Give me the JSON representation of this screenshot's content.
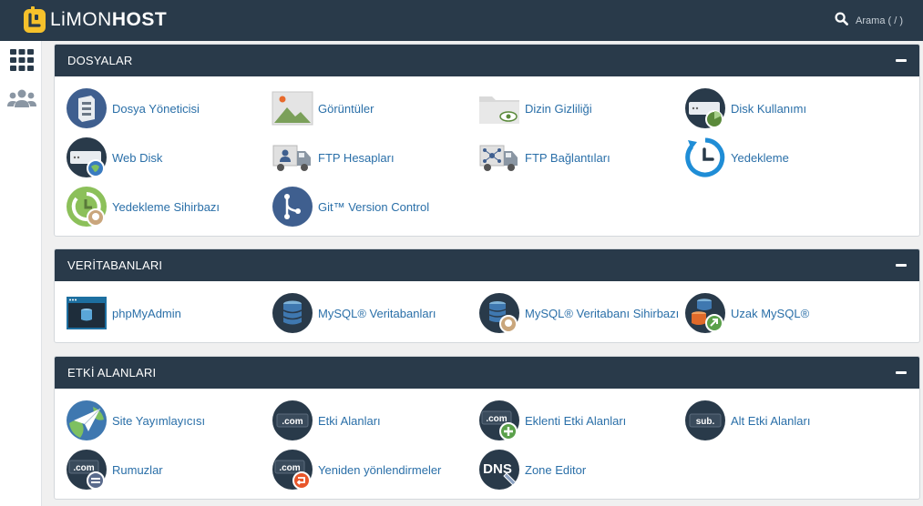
{
  "header": {
    "logo_prefix": "LiMON",
    "logo_suffix": "HOST",
    "search_label": "Arama ( / )"
  },
  "sidebar": {
    "items": [
      {
        "name": "apps-grid-icon"
      },
      {
        "name": "users-icon"
      }
    ]
  },
  "colors": {
    "topbar": "#293a4a",
    "panel_header": "#293a4a",
    "link": "#2a6fa8",
    "logo_yellow": "#f6c12b"
  },
  "panels": [
    {
      "title": "DOSYALAR",
      "items": [
        {
          "label": "Dosya Yöneticisi",
          "icon": "file-manager-icon"
        },
        {
          "label": "Görüntüler",
          "icon": "images-icon"
        },
        {
          "label": "Dizin Gizliliği",
          "icon": "directory-privacy-icon"
        },
        {
          "label": "Disk Kullanımı",
          "icon": "disk-usage-icon"
        },
        {
          "label": "Web Disk",
          "icon": "web-disk-icon"
        },
        {
          "label": "FTP Hesapları",
          "icon": "ftp-accounts-icon"
        },
        {
          "label": "FTP Bağlantıları",
          "icon": "ftp-connections-icon"
        },
        {
          "label": "Yedekleme",
          "icon": "backup-icon"
        },
        {
          "label": "Yedekleme Sihirbazı",
          "icon": "backup-wizard-icon"
        },
        {
          "label": "Git™ Version Control",
          "icon": "git-icon"
        }
      ]
    },
    {
      "title": "VERİTABANLARI",
      "items": [
        {
          "label": "phpMyAdmin",
          "icon": "phpmyadmin-icon"
        },
        {
          "label": "MySQL® Veritabanları",
          "icon": "mysql-databases-icon"
        },
        {
          "label": "MySQL® Veritabanı Sihirbazı",
          "icon": "mysql-wizard-icon"
        },
        {
          "label": "Uzak MySQL®",
          "icon": "remote-mysql-icon"
        }
      ]
    },
    {
      "title": "ETKİ ALANLARI",
      "items": [
        {
          "label": "Site Yayımlayıcısı",
          "icon": "site-publisher-icon",
          "icon_text": ""
        },
        {
          "label": "Etki Alanları",
          "icon": "domains-icon",
          "icon_text": ".com"
        },
        {
          "label": "Eklenti Etki Alanları",
          "icon": "addon-domains-icon",
          "icon_text": ".com"
        },
        {
          "label": "Alt Etki Alanları",
          "icon": "subdomains-icon",
          "icon_text": "sub."
        },
        {
          "label": "Rumuzlar",
          "icon": "aliases-icon",
          "icon_text": ".com"
        },
        {
          "label": "Yeniden yönlendirmeler",
          "icon": "redirects-icon",
          "icon_text": ".com"
        },
        {
          "label": "Zone Editor",
          "icon": "zone-editor-icon",
          "icon_text": "DNS"
        }
      ]
    }
  ]
}
